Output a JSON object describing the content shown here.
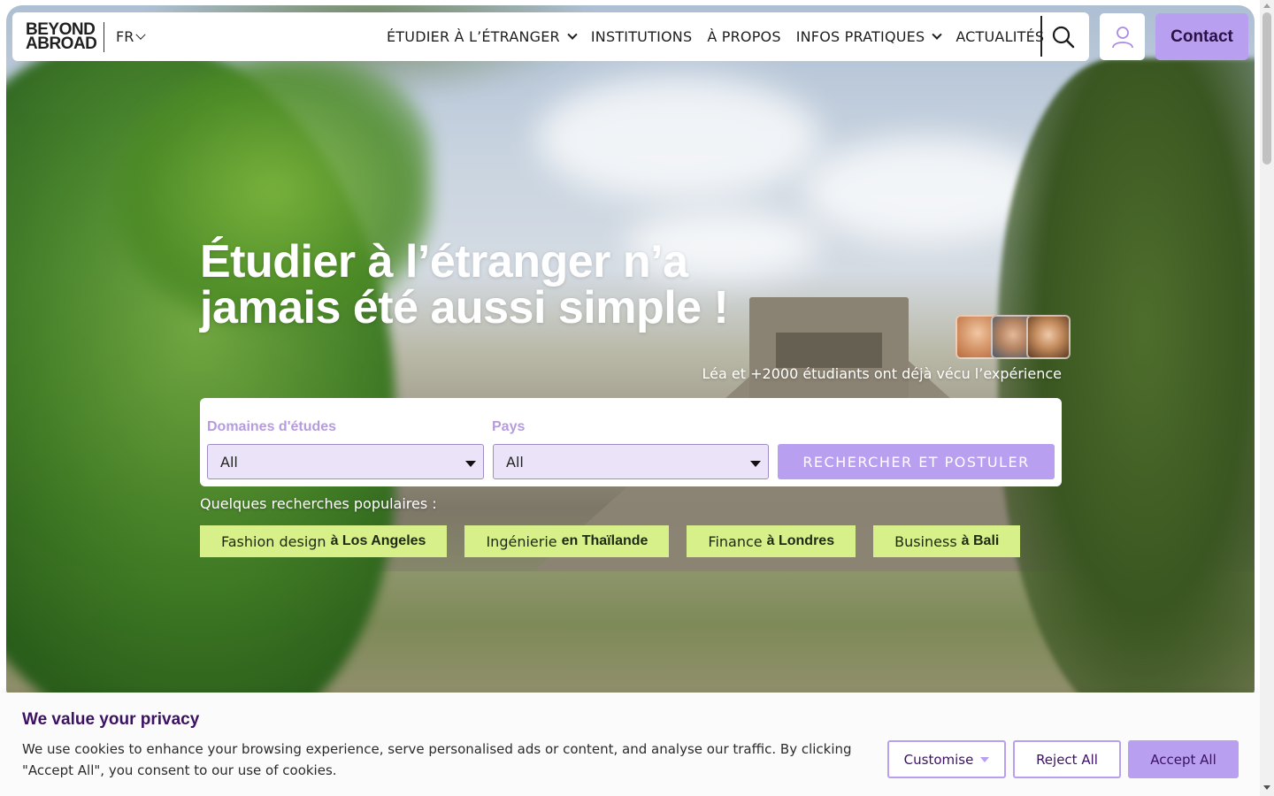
{
  "brand": {
    "logo_line1": "BEYOND",
    "logo_line2": "ABROAD",
    "accent": "#b89ff0",
    "chip_color": "#d7f089"
  },
  "nav": {
    "lang": "FR",
    "items": [
      {
        "label": "ÉTUDIER À L’ÉTRANGER",
        "dropdown": true
      },
      {
        "label": "INSTITUTIONS",
        "dropdown": false
      },
      {
        "label": "À PROPOS",
        "dropdown": false
      },
      {
        "label": "INFOS PRATIQUES",
        "dropdown": true
      },
      {
        "label": "ACTUALITÉS",
        "dropdown": false
      }
    ],
    "search_icon": "search-icon",
    "user_icon": "user-icon",
    "contact_label": "Contact"
  },
  "hero": {
    "headline_line1": "Étudier à l’étranger n’a",
    "headline_line2": "jamais été aussi simple !",
    "social_proof": "Léa et +2000 étudiants ont déjà vécu l’expérience"
  },
  "search": {
    "field1_label": "Domaines d'études",
    "field1_value": "All",
    "field2_label": "Pays",
    "field2_value": "All",
    "button_label": "RECHERCHER ET POSTULER"
  },
  "popular": {
    "label": "Quelques recherches populaires :",
    "chips": [
      {
        "field": "Fashion design",
        "place": "à Los Angeles"
      },
      {
        "field": "Ingénierie",
        "place": "en Thaïlande"
      },
      {
        "field": "Finance",
        "place": "à Londres"
      },
      {
        "field": "Business",
        "place": "à Bali"
      }
    ]
  },
  "cookie": {
    "title": "We value your privacy",
    "text": "We use cookies to enhance your browsing experience, serve personalised ads or content, and analyse our traffic. By clicking \"Accept All\", you consent to our use of cookies.",
    "customise": "Customise",
    "reject": "Reject All",
    "accept": "Accept All"
  }
}
